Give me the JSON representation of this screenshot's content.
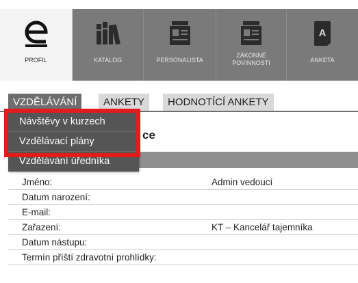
{
  "nav": {
    "tiles": [
      {
        "label": "PROFIL",
        "icon": "profile-e-icon"
      },
      {
        "label": "KATALOG",
        "icon": "books-icon"
      },
      {
        "label": "PERSONALISTA",
        "icon": "id-card-folder-icon"
      },
      {
        "label": "ZÁKONNÉ\nPOVINNOSTI",
        "icon": "law-folder-icon"
      },
      {
        "label": "ANKETA",
        "icon": "anketa-document-icon"
      }
    ]
  },
  "tabs": [
    {
      "label": "VZDĚLÁVÁNÍ"
    },
    {
      "label": "ANKETY"
    },
    {
      "label": "HODNOTÍCÍ ANKETY"
    }
  ],
  "dropdown": {
    "items": [
      {
        "label": "Návštěvy v kurzech"
      },
      {
        "label": "Vzdělávací plány"
      },
      {
        "label": "Vzdělávání úředníka"
      }
    ]
  },
  "section": {
    "title_tail": "ce"
  },
  "details": {
    "rows": [
      {
        "label": "Jméno:",
        "value": "Admin vedoucí"
      },
      {
        "label": "Datum narození:",
        "value": ""
      },
      {
        "label": "E-mail:",
        "value": ""
      },
      {
        "label": "Zařazení:",
        "value": "KT – Kancelář tajemníka"
      },
      {
        "label": "Datum nástupu:",
        "value": ""
      },
      {
        "label": "Termín příští zdravotní prohlídky:",
        "value": ""
      }
    ]
  },
  "colors": {
    "nav_bg": "#6e6e6e",
    "highlight": "#e31b1b",
    "dropdown_bg": "#555555"
  }
}
